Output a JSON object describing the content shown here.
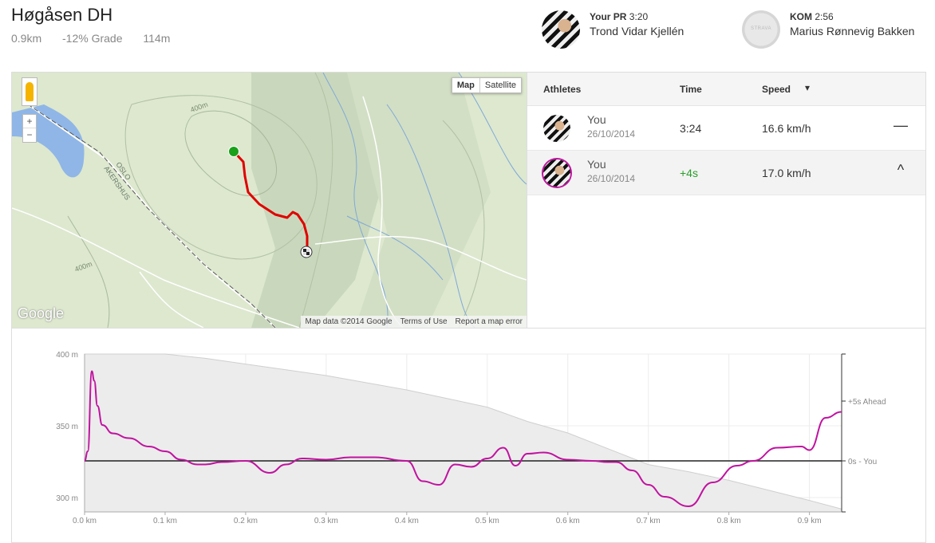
{
  "segment": {
    "title": "Høgåsen DH",
    "distance": "0.9km",
    "grade": "-12% Grade",
    "elev": "114m"
  },
  "your_pr": {
    "label": "Your PR",
    "time": "3:20",
    "name": "Trond Vidar Kjellén"
  },
  "kom": {
    "label": "KOM",
    "time": "2:56",
    "name": "Marius Rønnevig Bakken"
  },
  "map": {
    "toggle_map": "Map",
    "toggle_satellite": "Satellite",
    "zoom_in": "+",
    "zoom_out": "−",
    "logo": "Google",
    "credits": [
      "Map data ©2014 Google",
      "Terms of Use",
      "Report a map error"
    ],
    "labels": {
      "contour1": "400m",
      "contour2": "400m",
      "region1": "OSLO",
      "region2": "AKERSHUS"
    },
    "colors": {
      "route": "#e00000",
      "start": "#1aa01a",
      "water": "#8fb6e6"
    }
  },
  "leaderboard": {
    "headers": {
      "athletes": "Athletes",
      "time": "Time",
      "speed": "Speed",
      "sort_icon": "▾"
    },
    "rows": [
      {
        "name": "You",
        "date": "26/10/2014",
        "time": "3:24",
        "speed": "16.6 km/h",
        "control": "—",
        "selected": false
      },
      {
        "name": "You",
        "date": "26/10/2014",
        "time": "+4s",
        "speed": "17.0 km/h",
        "control": "^",
        "selected": true
      }
    ]
  },
  "chart_data": {
    "type": "line",
    "xlabel": "",
    "ylabel": "",
    "x_ticks": [
      "0.0 km",
      "0.1 km",
      "0.2 km",
      "0.3 km",
      "0.4 km",
      "0.5 km",
      "0.6 km",
      "0.7 km",
      "0.8 km",
      "0.9 km"
    ],
    "y_ticks_left": [
      "400 m",
      "350 m",
      "300 m"
    ],
    "y_ticks_right": [
      "+5s Ahead",
      "0s - You"
    ],
    "xlim": [
      0,
      0.94
    ],
    "ylim": [
      290,
      400
    ],
    "grid": true,
    "colors": {
      "elevation_fill": "#ececec",
      "elevation_line": "#cfcfcf",
      "gap_line": "#c0139f",
      "baseline": "#222222"
    },
    "elevation": {
      "x": [
        0,
        0.05,
        0.1,
        0.15,
        0.2,
        0.25,
        0.3,
        0.35,
        0.4,
        0.45,
        0.5,
        0.55,
        0.6,
        0.65,
        0.7,
        0.75,
        0.8,
        0.85,
        0.9,
        0.94
      ],
      "y": [
        400,
        400,
        400,
        397,
        393,
        389,
        385,
        380,
        375,
        369,
        363,
        353,
        345,
        334,
        323,
        318,
        312,
        305,
        298,
        292
      ]
    },
    "series": [
      {
        "x": [
          0,
          0.004,
          0.009,
          0.012,
          0.016,
          0.022,
          0.035,
          0.055,
          0.08,
          0.1,
          0.12,
          0.14,
          0.15,
          0.17,
          0.2,
          0.23,
          0.25,
          0.27,
          0.3,
          0.33,
          0.36,
          0.4,
          0.42,
          0.44,
          0.46,
          0.48,
          0.5,
          0.52,
          0.535,
          0.55,
          0.57,
          0.6,
          0.63,
          0.65,
          0.66,
          0.68,
          0.7,
          0.72,
          0.75,
          0.78,
          0.81,
          0.83,
          0.86,
          0.89,
          0.9,
          0.92,
          0.94
        ],
        "y": [
          0,
          0.8,
          7.5,
          6.7,
          4.6,
          3.0,
          2.3,
          1.9,
          1.2,
          0.8,
          0.1,
          -0.3,
          -0.3,
          -0.1,
          0.0,
          -1.0,
          -0.3,
          0.2,
          0.1,
          0.3,
          0.3,
          0.0,
          -1.7,
          -2.0,
          -0.3,
          -0.5,
          0.2,
          1.1,
          -0.4,
          0.6,
          0.7,
          0.1,
          0.0,
          -0.1,
          -0.1,
          -0.8,
          -2.0,
          -3.0,
          -3.8,
          -1.8,
          -0.4,
          0.0,
          1.1,
          1.2,
          0.9,
          3.6,
          4.1
        ]
      }
    ]
  }
}
